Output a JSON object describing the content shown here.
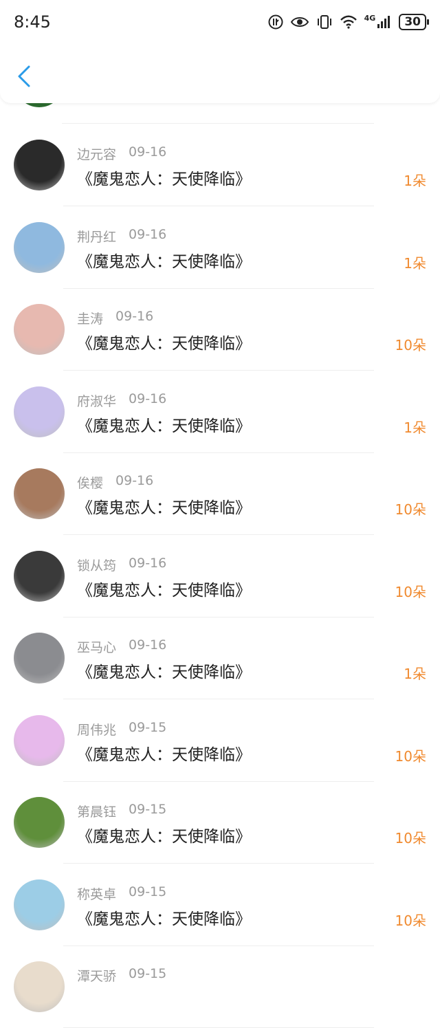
{
  "status_bar": {
    "time": "8:45",
    "network": "4G",
    "battery": "30"
  },
  "colors": {
    "accent": "#2a9be8",
    "amount": "#f08a2f",
    "meta": "#9a9a9a"
  },
  "rows": [
    {
      "name": "边元容",
      "date": "09-16",
      "title": "《魔鬼恋人：天使降临》",
      "amount": "1朵",
      "avatar_color": "#2a2a2a"
    },
    {
      "name": "荆丹红",
      "date": "09-16",
      "title": "《魔鬼恋人：天使降临》",
      "amount": "1朵",
      "avatar_color": "#8fb9df"
    },
    {
      "name": "圭涛",
      "date": "09-16",
      "title": "《魔鬼恋人：天使降临》",
      "amount": "10朵",
      "avatar_color": "#e7b9b0"
    },
    {
      "name": "府淑华",
      "date": "09-16",
      "title": "《魔鬼恋人：天使降临》",
      "amount": "1朵",
      "avatar_color": "#c9c0ec"
    },
    {
      "name": "俟樱",
      "date": "09-16",
      "title": "《魔鬼恋人：天使降临》",
      "amount": "10朵",
      "avatar_color": "#a77a5e"
    },
    {
      "name": "锁从筠",
      "date": "09-16",
      "title": "《魔鬼恋人：天使降临》",
      "amount": "10朵",
      "avatar_color": "#3a3a3a"
    },
    {
      "name": "巫马心",
      "date": "09-16",
      "title": "《魔鬼恋人：天使降临》",
      "amount": "1朵",
      "avatar_color": "#8b8c90"
    },
    {
      "name": "周伟兆",
      "date": "09-15",
      "title": "《魔鬼恋人：天使降临》",
      "amount": "10朵",
      "avatar_color": "#e7b9eb"
    },
    {
      "name": "第晨钰",
      "date": "09-15",
      "title": "《魔鬼恋人：天使降临》",
      "amount": "10朵",
      "avatar_color": "#5f8f3b"
    },
    {
      "name": "称英卓",
      "date": "09-15",
      "title": "《魔鬼恋人：天使降临》",
      "amount": "10朵",
      "avatar_color": "#9ccde6"
    },
    {
      "name": "潭天骄",
      "date": "09-15",
      "title": "",
      "amount": "",
      "avatar_color": "#e8dccc"
    }
  ]
}
